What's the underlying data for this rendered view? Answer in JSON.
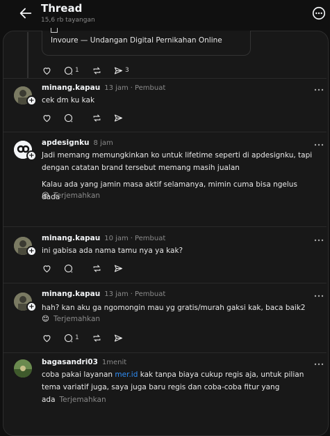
{
  "header": {
    "title": "Thread",
    "views": "15,6 rb tayangan"
  },
  "quoted_card": {
    "text": "Invoure — Undangan Digital Pernikahan Online"
  },
  "top_actions": {
    "replies": "1",
    "shares": "3"
  },
  "posts": [
    {
      "username": "minang.kapau",
      "time": "13 jam",
      "author_label": "Pembuat",
      "text": "cek dm ku kak"
    },
    {
      "username": "apdesignku",
      "time": "8 jam",
      "text": "Jadi memang memungkinkan ko untuk lifetime seperti di apdesignku, tapi dengan catatan brand tersebut memang masih jualan",
      "text2": "Kalau ada yang jamin masa aktif selamanya, mimin cuma bisa ngelus dada",
      "emoji": "😔",
      "translate": "Terjemahkan"
    },
    {
      "username": "minang.kapau",
      "time": "10 jam",
      "author_label": "Pembuat",
      "text": "ini gabisa ada nama tamu nya ya kak?"
    },
    {
      "username": "minang.kapau",
      "time": "13 jam",
      "author_label": "Pembuat",
      "text": "hah? kan aku ga ngomongin mau yg gratis/murah gaksi kak, baca baik2",
      "emoji": "😊",
      "translate": "Terjemahkan",
      "replies": "1"
    },
    {
      "username": "bagasandri03",
      "time": "1menit",
      "text_a": "coba pakai layanan ",
      "link": "mer.id",
      "text_b": " kak tanpa biaya cukup regis aja, untuk pilian tema variatif juga, saya juga baru regis dan coba-coba fitur yang ada",
      "translate": "Terjemahkan"
    }
  ],
  "colors": {
    "background": "#101010",
    "panel": "#181818",
    "link": "#2f8ef7",
    "muted": "#8a8a8a"
  }
}
